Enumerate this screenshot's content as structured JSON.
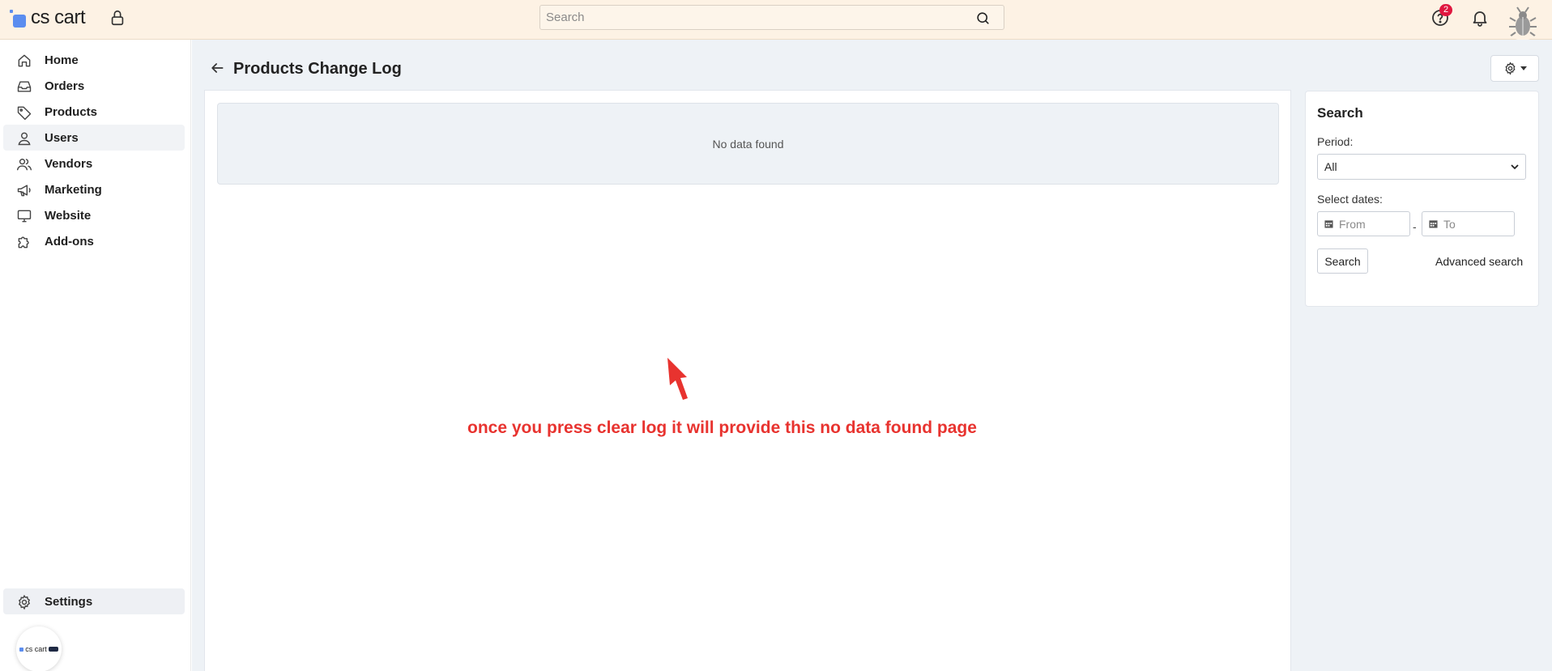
{
  "topbar": {
    "logo_text": "cs cart",
    "search_placeholder": "Search",
    "help_badge_count": "2",
    "icons": [
      "lock-icon",
      "search-icon",
      "help-icon",
      "bell-icon",
      "avatar"
    ]
  },
  "sidebar": {
    "items": [
      {
        "label": "Home",
        "icon": "home-icon"
      },
      {
        "label": "Orders",
        "icon": "inbox-icon"
      },
      {
        "label": "Products",
        "icon": "tag-icon"
      },
      {
        "label": "Users",
        "icon": "user-icon",
        "active": true
      },
      {
        "label": "Vendors",
        "icon": "users-icon"
      },
      {
        "label": "Marketing",
        "icon": "megaphone-icon"
      },
      {
        "label": "Website",
        "icon": "monitor-icon"
      },
      {
        "label": "Add-ons",
        "icon": "puzzle-icon"
      }
    ],
    "settings_label": "Settings",
    "mini_logo_text": "cs cart"
  },
  "main": {
    "title": "Products Change Log",
    "empty_message": "No data found",
    "annotation": "once you press clear log it will provide this no data found page"
  },
  "search_panel": {
    "title": "Search",
    "period_label": "Period:",
    "period_value": "All",
    "dates_label": "Select dates:",
    "from_placeholder": "From",
    "to_placeholder": "To",
    "date_separator": "-",
    "search_button": "Search",
    "advanced_link": "Advanced search"
  },
  "colors": {
    "topbar_bg": "#fdf2e4",
    "main_bg": "#eef2f6",
    "accent": "#5b8def",
    "badge": "#e0173f",
    "annotation": "#e8332f"
  }
}
